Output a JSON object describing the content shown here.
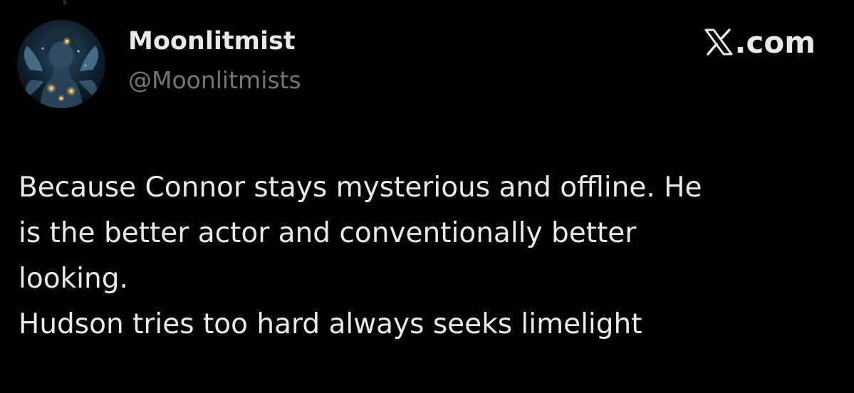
{
  "author": {
    "display_name": "Moonlitmist",
    "handle": "@Moonlitmists",
    "avatar_icon": "fairy-avatar-icon"
  },
  "brand": {
    "text": ".com",
    "logo_icon": "x-logo-icon",
    "accent": "#e7e9ea"
  },
  "post": {
    "lines": [
      "Because Connor stays mysterious and offline. He",
      "is the better actor and conventionally better",
      "looking.",
      "Hudson tries too hard always seeks limelight"
    ]
  },
  "colors": {
    "background": "#000000",
    "primary_text": "#e7e9ea",
    "secondary_text": "#71767b"
  }
}
